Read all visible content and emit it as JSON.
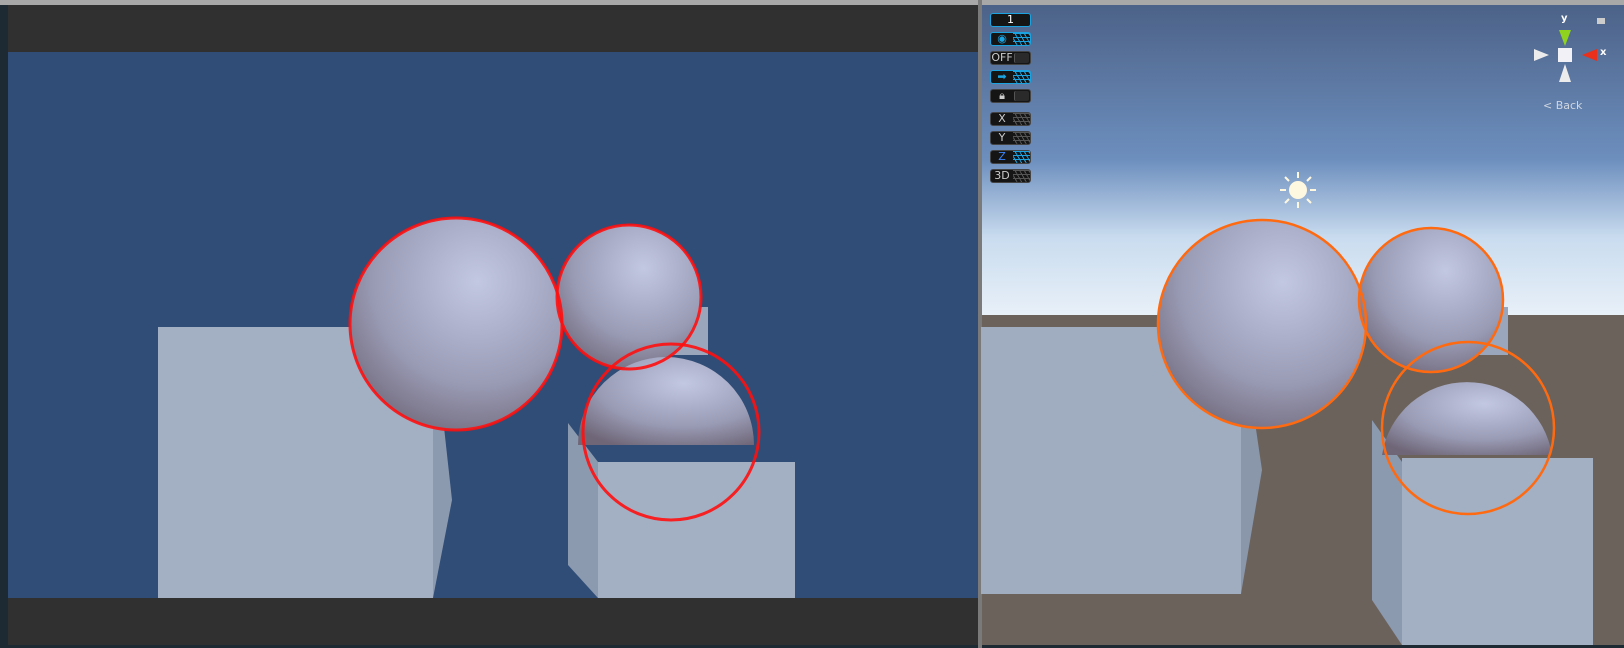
{
  "scene_overlay": {
    "layer_value": "1",
    "visibility_label": "eye",
    "toggle_off_label": "OFF",
    "move_label": "arrow",
    "lock_label": "lock",
    "axis_x_label": "X",
    "axis_y_label": "Y",
    "axis_z_label": "Z",
    "mode_3d_label": "3D"
  },
  "gizmo": {
    "y_label": "y",
    "x_label": "x",
    "back_label": "< Back"
  },
  "colors": {
    "game_bg": "#2f4d76",
    "game_outline": "#ff0000",
    "scene_outline": "#ff6a10",
    "ground": "#6b625c"
  }
}
